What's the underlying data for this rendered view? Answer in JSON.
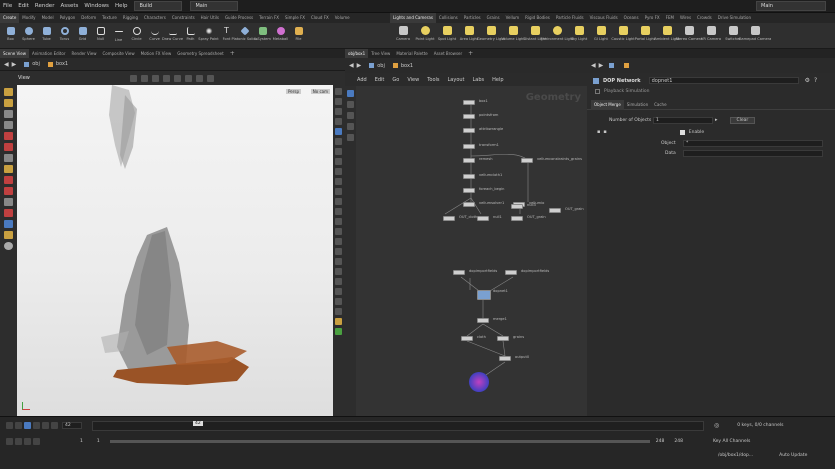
{
  "menubar": {
    "items": [
      "File",
      "Edit",
      "Render",
      "Assets",
      "Windows",
      "Help"
    ],
    "desktop": "Build",
    "context": "Main",
    "right_desktop": "Main"
  },
  "shelf_tabs": [
    "Create",
    "Modify",
    "Model",
    "Polygon",
    "Deform",
    "Texture",
    "Rigging",
    "Characters",
    "Constraints",
    "Hair Utils",
    "Guide Process",
    "Terrain FX",
    "Simple FX",
    "Cloud FX",
    "Volume"
  ],
  "shelf_tools": [
    {
      "label": "Box",
      "color": "#8fb0d8"
    },
    {
      "label": "Sphere",
      "color": "#8fb0d8"
    },
    {
      "label": "Tube",
      "color": "#8fb0d8"
    },
    {
      "label": "Torus",
      "color": "#8fb0d8"
    },
    {
      "label": "Grid",
      "color": "#8fb0d8"
    },
    {
      "label": "Null",
      "color": "#d0d0d0"
    },
    {
      "label": "Line",
      "color": "#d0d0d0"
    },
    {
      "label": "Circle",
      "color": "#d0d0d0"
    },
    {
      "label": "Curve",
      "color": "#d0d0d0"
    },
    {
      "label": "Draw Curve",
      "color": "#d0d0d0"
    },
    {
      "label": "Path",
      "color": "#d0d0d0"
    },
    {
      "label": "Spray Paint",
      "color": "#d0d0d0"
    },
    {
      "label": "Font",
      "color": "#d0d0d0"
    },
    {
      "label": "Platonic Solids",
      "color": "#8fb0d8"
    },
    {
      "label": "L-System",
      "color": "#7fbf7f"
    },
    {
      "label": "Metaball",
      "color": "#d070d0"
    },
    {
      "label": "File",
      "color": "#e0b050"
    }
  ],
  "shelf2_tabs": [
    "Lights and Cameras",
    "Collisions",
    "Particles",
    "Grains",
    "Vellum",
    "Rigid Bodies",
    "Particle Fluids",
    "Viscous Fluids",
    "Oceans",
    "Pyro FX",
    "FEM",
    "Wires",
    "Crowds",
    "Drive Simulation"
  ],
  "shelf2_tools": [
    {
      "label": "Camera",
      "color": "#c8c8c8"
    },
    {
      "label": "Point Light",
      "color": "#e8d060"
    },
    {
      "label": "Spot Light",
      "color": "#e8d060"
    },
    {
      "label": "Area Light",
      "color": "#e8d060"
    },
    {
      "label": "Geometry Light",
      "color": "#e8d060"
    },
    {
      "label": "Volume Light",
      "color": "#e8d060"
    },
    {
      "label": "Distant Light",
      "color": "#e8d060"
    },
    {
      "label": "Environment Light",
      "color": "#e8d060"
    },
    {
      "label": "Sky Light",
      "color": "#e8d060"
    },
    {
      "label": "GI Light",
      "color": "#e8d060"
    },
    {
      "label": "Caustic Light",
      "color": "#e8d060"
    },
    {
      "label": "Portal Light",
      "color": "#e8d060"
    },
    {
      "label": "Ambient Light",
      "color": "#e8d060"
    },
    {
      "label": "Stereo Camera",
      "color": "#c8c8c8"
    },
    {
      "label": "VR Camera",
      "color": "#c8c8c8"
    },
    {
      "label": "Switcher",
      "color": "#c8c8c8"
    },
    {
      "label": "Gamepad Camera",
      "color": "#c8c8c8"
    }
  ],
  "viewer": {
    "tabs": [
      "Scene View",
      "Animation Editor",
      "Render View",
      "Composite View",
      "Motion FX View",
      "Geometry Spreadsheet"
    ],
    "path": [
      "obj",
      "box1"
    ],
    "view_label": "View",
    "persp": "Persp",
    "cam": "No cam"
  },
  "network": {
    "tabs": [
      "obj/box1",
      "Tree View",
      "Material Palette",
      "Asset Browser"
    ],
    "path": [
      "obj",
      "box1"
    ],
    "menu": [
      "Add",
      "Edit",
      "Go",
      "View",
      "Tools",
      "Layout",
      "Labs",
      "Help"
    ],
    "watermark": "Geometry"
  },
  "network_nodes": [
    {
      "label": "box1"
    },
    {
      "label": "pointsfrom"
    },
    {
      "label": "attribwrangle"
    },
    {
      "label": "transform1"
    },
    {
      "label": "remesh"
    },
    {
      "label": "vellumcloth1"
    },
    {
      "label": "foreach_begin"
    },
    {
      "label": "vellumsolver1"
    },
    {
      "label": "vellumio"
    },
    {
      "label": "OUT_cloth"
    },
    {
      "label": "null1"
    },
    {
      "label": "vellumconstraints_grains"
    },
    {
      "label": "null3"
    },
    {
      "label": "OUT_grain"
    },
    {
      "label": "OUT_grain"
    },
    {
      "label": "dopimportfields"
    },
    {
      "label": "dopimportfields"
    },
    {
      "label": "dopnet1"
    },
    {
      "label": "merge1"
    },
    {
      "label": "cloth"
    },
    {
      "label": "grains"
    },
    {
      "label": "output0"
    }
  ],
  "parms": {
    "type_label": "DOP Network",
    "node_name": "dopnet1",
    "playback_label": "Playback Simulation",
    "tabs": [
      "Object Merge",
      "Simulation",
      "Cache"
    ],
    "num_objects_label": "Number of Objects",
    "num_objects": "1",
    "clear_label": "Clear",
    "enable_label": "Enable",
    "object_label": "Object",
    "object_value": "*",
    "data_label": "Data",
    "data_value": ""
  },
  "timeline": {
    "current_frame": "42",
    "marker": "42",
    "start": "1",
    "start2": "1",
    "end": "248",
    "end2": "248",
    "keys_label": "0 keys, 0/0 channels",
    "all_channels": "Key All Channels",
    "path_status": "/obj/box1/dop...",
    "auto_update": "Auto Update"
  }
}
